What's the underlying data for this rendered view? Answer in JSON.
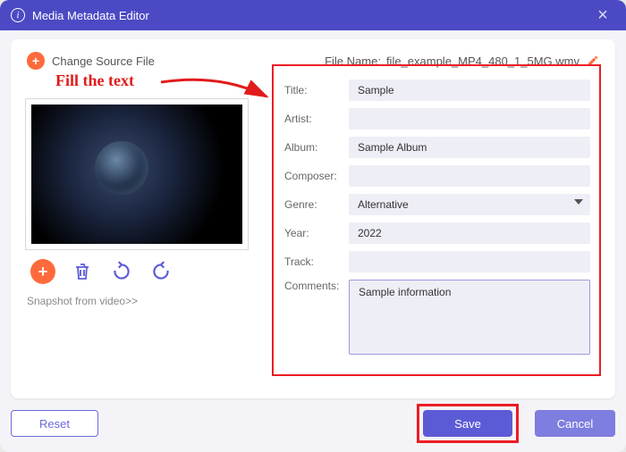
{
  "window": {
    "title": "Media Metadata Editor"
  },
  "top": {
    "change_source": "Change Source File",
    "file_name_label": "File Name:",
    "file_name": "file_example_MP4_480_1_5MG.wmv"
  },
  "annotation": "Fill the text",
  "left": {
    "snapshot_link": "Snapshot from video>>"
  },
  "fields": {
    "title_label": "Title:",
    "title_value": "Sample",
    "artist_label": "Artist:",
    "artist_value": "",
    "album_label": "Album:",
    "album_value": "Sample Album",
    "composer_label": "Composer:",
    "composer_value": "",
    "genre_label": "Genre:",
    "genre_value": "Alternative",
    "year_label": "Year:",
    "year_value": "2022",
    "track_label": "Track:",
    "track_value": "",
    "comments_label": "Comments:",
    "comments_value": "Sample information"
  },
  "footer": {
    "reset": "Reset",
    "save": "Save",
    "cancel": "Cancel"
  }
}
